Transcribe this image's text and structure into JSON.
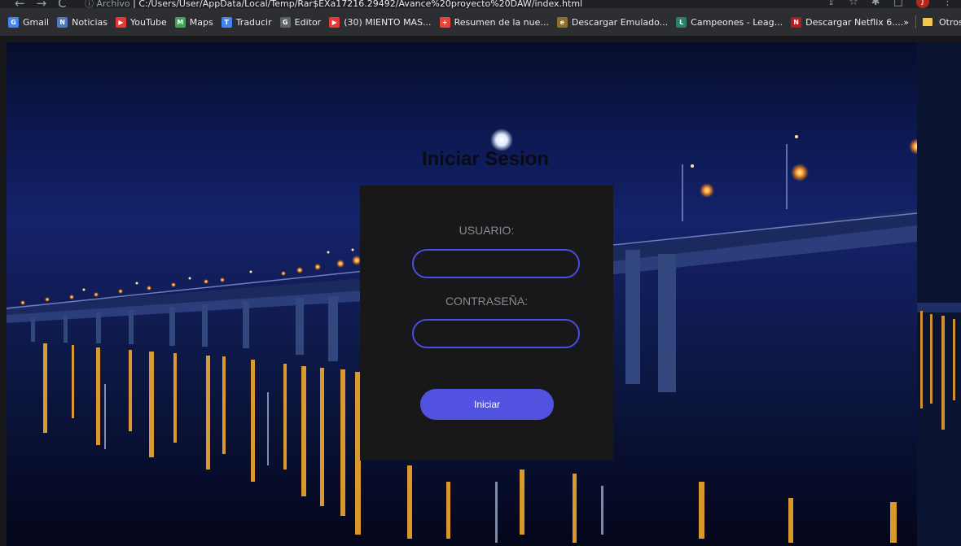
{
  "browser": {
    "url_scheme": "ⓘ Archivo",
    "url": "C:/Users/User/AppData/Local/Temp/Rar$EXa17216.29492/Avance%20proyecto%20DAW/index.html",
    "avatar_letter": "J"
  },
  "bookmarks": [
    {
      "label": "Gmail",
      "icon": "google-icon",
      "color": "#4285f4",
      "glyph": "G"
    },
    {
      "label": "Noticias",
      "icon": "news-icon",
      "color": "#4a78c2",
      "glyph": "N"
    },
    {
      "label": "YouTube",
      "icon": "youtube-icon",
      "color": "#e53935",
      "glyph": "▶"
    },
    {
      "label": "Maps",
      "icon": "maps-icon",
      "color": "#34a853",
      "glyph": "M"
    },
    {
      "label": "Traducir",
      "icon": "translate-icon",
      "color": "#4285f4",
      "glyph": "T"
    },
    {
      "label": "Editor",
      "icon": "editor-icon",
      "color": "#5f6368",
      "glyph": "G"
    },
    {
      "label": "(30) MIENTO MAS...",
      "icon": "youtube-icon",
      "color": "#e53935",
      "glyph": "▶"
    },
    {
      "label": "Resumen de la nue...",
      "icon": "plus-icon",
      "color": "#e8453c",
      "glyph": "+"
    },
    {
      "label": "Descargar Emulado...",
      "icon": "emulator-icon",
      "color": "#8d6e2f",
      "glyph": "e"
    },
    {
      "label": "Campeones - Leag...",
      "icon": "league-icon",
      "color": "#2e7d6b",
      "glyph": "L"
    },
    {
      "label": "Descargar Netflix 6....",
      "icon": "netflix-icon",
      "color": "#b71c1c",
      "glyph": "N"
    }
  ],
  "bookmarks_overflow": "»",
  "other_bookmarks": "Otros marcadores",
  "login": {
    "title": "Iniciar Sesion",
    "user_label": "USUARIO:",
    "password_label": "CONTRASEÑA:",
    "user_value": "",
    "password_value": "",
    "submit": "Iniciar"
  },
  "colors": {
    "accent": "#5153e0",
    "field_border": "#4a4ee0",
    "panel": "#18181a"
  }
}
